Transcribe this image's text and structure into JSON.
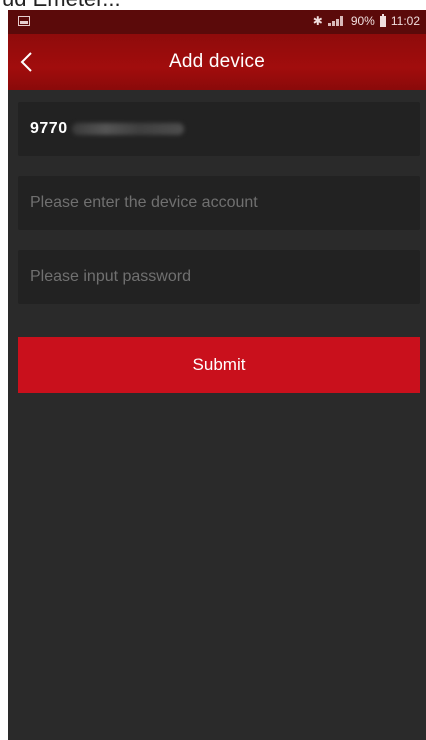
{
  "top_caption": "ud Emeter...",
  "status_bar": {
    "battery_percent": "90%",
    "time": "11:02",
    "bluetooth_icon": "bluetooth-icon",
    "signal_icon": "signal-icon",
    "battery_icon": "battery-icon",
    "notification_icon": "image-notification-icon"
  },
  "header": {
    "title": "Add device",
    "back_icon": "chevron-left-icon"
  },
  "form": {
    "device_id_value": "9770",
    "account_placeholder": "Please enter the device account",
    "password_placeholder": "Please input password",
    "submit_label": "Submit"
  },
  "colors": {
    "status_bar": "#5b0a0a",
    "app_bar": "#a10d0d",
    "background": "#2a2a2a",
    "field": "#222222",
    "accent": "#c9101c"
  }
}
